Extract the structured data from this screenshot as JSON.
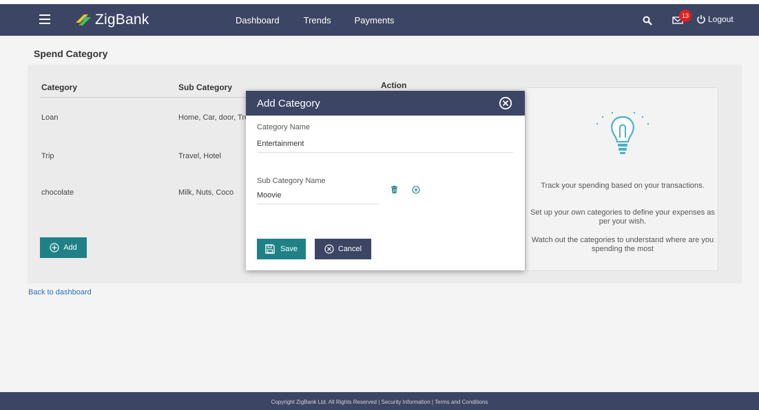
{
  "header": {
    "brand": "ZigBank",
    "nav": [
      "Dashboard",
      "Trends",
      "Payments"
    ],
    "notification_count": "13",
    "logout_label": "Logout"
  },
  "page": {
    "title": "Spend Category",
    "columns": [
      "Category",
      "Sub Category",
      "Action"
    ],
    "rows": [
      {
        "category": "Loan",
        "sub_category": "Home, Car, door, Tre"
      },
      {
        "category": "Trip",
        "sub_category": "Travel, Hotel"
      },
      {
        "category": "chocolate",
        "sub_category": "Milk, Nuts, Coco"
      }
    ],
    "add_label": "Add",
    "back_link": "Back to dashboard"
  },
  "info": {
    "line1": "Track your spending based on your transactions.",
    "line2": "Set up your own categories to define your expenses as per your wish.",
    "line3": "Watch out the categories to understand where are you spending the most"
  },
  "modal": {
    "title": "Add Category",
    "category_name_label": "Category Name",
    "category_name_value": "Entertainment",
    "sub_category_label": "Sub Category Name",
    "sub_category_value": "Moovie",
    "save_label": "Save",
    "cancel_label": "Cancel"
  },
  "footer": {
    "text": "Copyright ZigBank Ltd. All Rights Reserved | Security Information | Terms and Conditions"
  },
  "colors": {
    "header": "#3c4563",
    "accent": "#1f8186",
    "badge": "#e02020"
  }
}
